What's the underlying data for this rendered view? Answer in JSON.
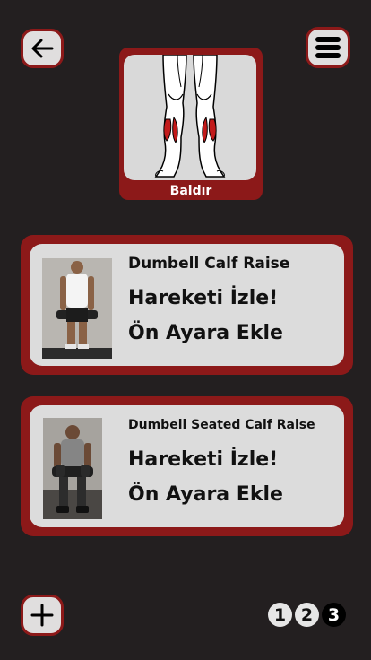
{
  "header": {
    "back_icon": "arrow-left-icon",
    "menu_icon": "hamburger-menu-icon"
  },
  "muscle": {
    "label": "Baldır",
    "icon": "calf-muscle-legs-illustration"
  },
  "exercises": [
    {
      "title": "Dumbell Calf Raise",
      "watch_label": "Hareketi İzle!",
      "add_label": "Ön Ayara Ekle"
    },
    {
      "title": "Dumbell Seated Calf Raise",
      "watch_label": "Hareketi İzle!",
      "add_label": "Ön Ayara Ekle"
    }
  ],
  "footer": {
    "add_icon": "plus-icon",
    "pages": [
      "1",
      "2",
      "3"
    ],
    "active_page": "3"
  },
  "colors": {
    "background": "#231f20",
    "accent": "#8c1919",
    "card": "#dcdcdc",
    "muscle_highlight": "#c21a1a"
  }
}
